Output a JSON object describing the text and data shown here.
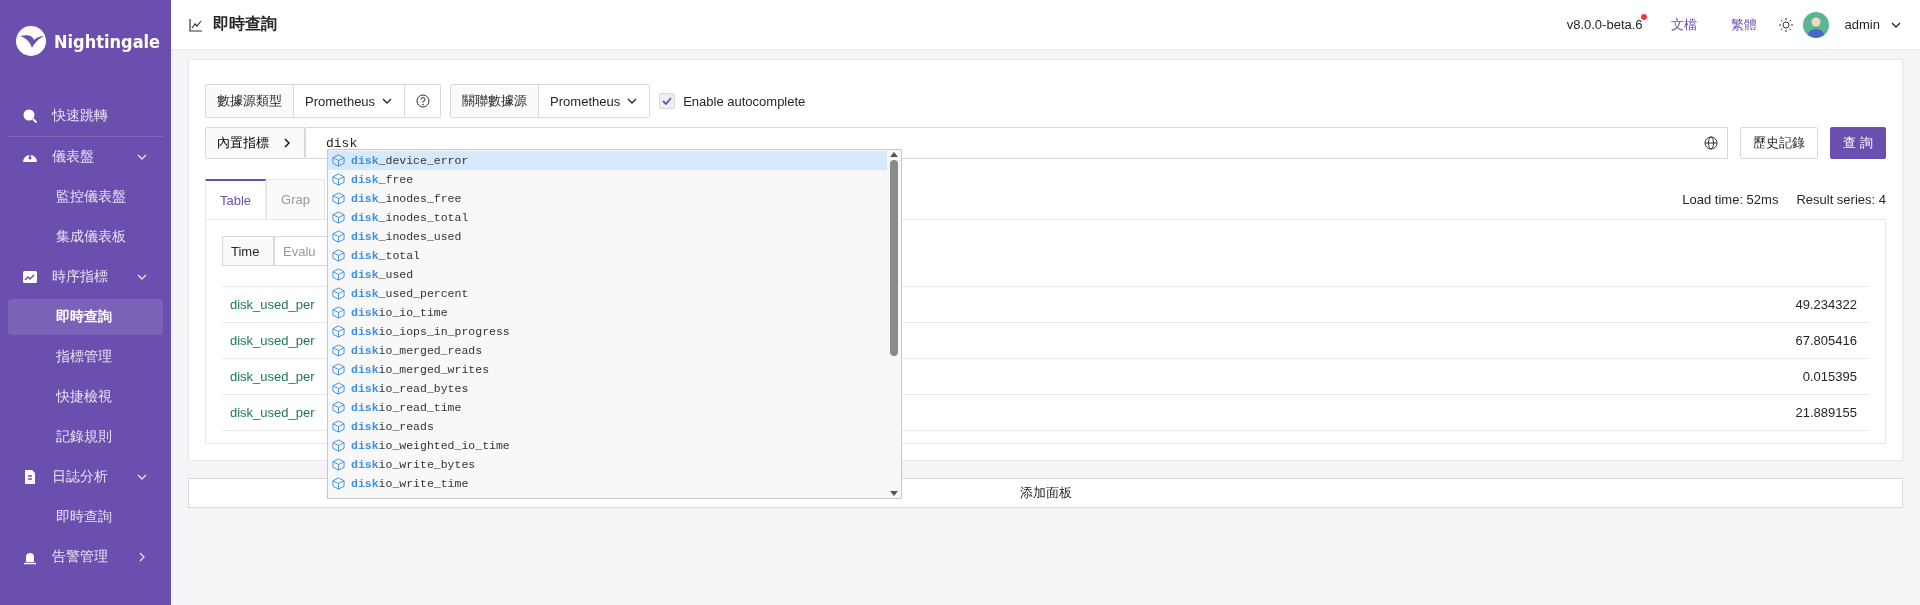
{
  "sidebar": {
    "brand": "Nightingale",
    "items": [
      {
        "label": "快速跳轉"
      },
      {
        "label": "儀表盤",
        "expanded": true,
        "children": [
          {
            "label": "監控儀表盤",
            "selected": false
          },
          {
            "label": "集成儀表板",
            "selected": false
          }
        ]
      },
      {
        "label": "時序指標",
        "expanded": true,
        "children": [
          {
            "label": "即時查詢",
            "selected": true
          },
          {
            "label": "指標管理",
            "selected": false
          },
          {
            "label": "快捷檢視",
            "selected": false
          },
          {
            "label": "記錄規則",
            "selected": false
          }
        ]
      },
      {
        "label": "日誌分析",
        "expanded": true,
        "children": [
          {
            "label": "即時查詢",
            "selected": false
          }
        ]
      },
      {
        "label": "告警管理",
        "expanded": false
      }
    ]
  },
  "header": {
    "title": "即時查詢",
    "version": "v8.0.0-beta.6",
    "version_badge": true,
    "links": [
      "文檔",
      "繁體"
    ],
    "user": "admin"
  },
  "toolbar": {
    "datasource_type_label": "數據源類型",
    "datasource_type": "Prometheus",
    "datasource_label": "關聯數據源",
    "datasource": "Prometheus",
    "autocomplete": {
      "label": "Enable autocomplete",
      "checked": true
    }
  },
  "query": {
    "builtin_label": "內置指標",
    "value": "disk",
    "history_button": "歷史記錄",
    "query_button": "查 詢"
  },
  "suggestions": [
    {
      "text": "**disk**_device_error",
      "selected": true
    },
    {
      "text": "**disk**_free",
      "selected": false
    },
    {
      "text": "**disk**_inodes_free",
      "selected": false
    },
    {
      "text": "**disk**_inodes_total",
      "selected": false
    },
    {
      "text": "**disk**_inodes_used",
      "selected": false
    },
    {
      "text": "**disk**_total",
      "selected": false
    },
    {
      "text": "**disk**_used",
      "selected": false
    },
    {
      "text": "**disk**_used_percent",
      "selected": false
    },
    {
      "text": "**disk**io_io_time",
      "selected": false
    },
    {
      "text": "**disk**io_iops_in_progress",
      "selected": false
    },
    {
      "text": "**disk**io_merged_reads",
      "selected": false
    },
    {
      "text": "**disk**io_merged_writes",
      "selected": false
    },
    {
      "text": "**disk**io_read_bytes",
      "selected": false
    },
    {
      "text": "**disk**io_read_time",
      "selected": false
    },
    {
      "text": "**disk**io_reads",
      "selected": false
    },
    {
      "text": "**disk**io_weighted_io_time",
      "selected": false
    },
    {
      "text": "**disk**io_write_bytes",
      "selected": false
    },
    {
      "text": "**disk**io_write_time",
      "selected": false
    }
  ],
  "tabs": [
    {
      "label": "Table",
      "selected": true
    },
    {
      "label": "Grap",
      "selected": false
    }
  ],
  "stats": [
    "Load time: 52ms",
    "Result series: 4"
  ],
  "time_toggle": [
    {
      "label": "Time",
      "selected": true
    },
    {
      "label": "Evalu",
      "selected": false
    }
  ],
  "rows": [
    {
      "metric": "disk_used_per",
      "value": "49.234322"
    },
    {
      "metric": "disk_used_per",
      "value": "67.805416"
    },
    {
      "metric": "disk_used_per",
      "value": "0.015395"
    },
    {
      "metric": "disk_used_per",
      "value": "21.889155"
    }
  ],
  "add_panel": "添加面板"
}
